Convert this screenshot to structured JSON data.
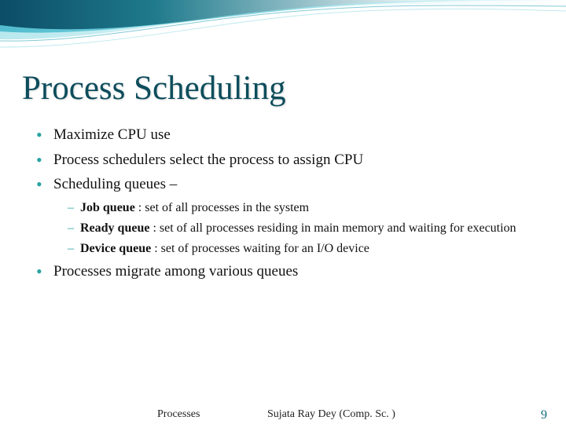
{
  "title": "Process Scheduling",
  "bullets": [
    {
      "text": "Maximize CPU use"
    },
    {
      "text": "Process schedulers select the process to assign CPU"
    },
    {
      "text": "Scheduling queues –",
      "sub": [
        {
          "bold": "Job queue",
          "rest": " : set of all processes in the system"
        },
        {
          "bold": "Ready queue",
          "rest": " : set of all processes residing in main memory and waiting for execution"
        },
        {
          "bold": "Device queue",
          "rest": " : set of processes waiting for an I/O device"
        }
      ]
    },
    {
      "text": "Processes migrate among various queues"
    }
  ],
  "footer": {
    "left": "Processes",
    "center": "Sujata Ray Dey (Comp. Sc. )",
    "page": "9"
  }
}
